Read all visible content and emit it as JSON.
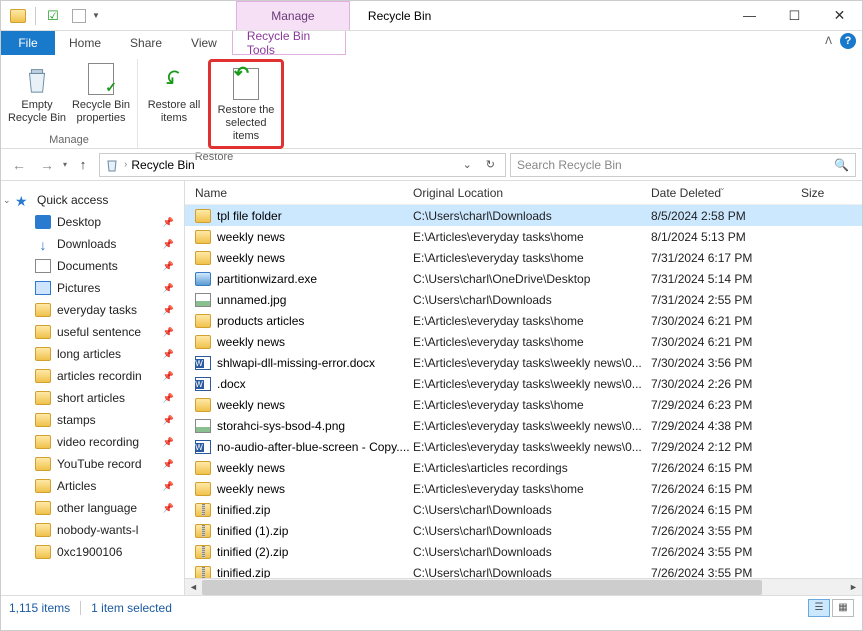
{
  "window": {
    "title": "Recycle Bin",
    "context_tab_header": "Manage",
    "min": "—",
    "max": "☐",
    "close": "✕"
  },
  "tabs": {
    "file": "File",
    "home": "Home",
    "share": "Share",
    "view": "View",
    "recycle_tools": "Recycle Bin Tools"
  },
  "ribbon": {
    "manage": {
      "label": "Manage",
      "empty": "Empty Recycle Bin",
      "props": "Recycle Bin properties"
    },
    "restore": {
      "label": "Restore",
      "all": "Restore all items",
      "selected": "Restore the selected items"
    }
  },
  "nav": {
    "location": "Recycle Bin",
    "search_placeholder": "Search Recycle Bin"
  },
  "columns": {
    "name": "Name",
    "loc": "Original Location",
    "date": "Date Deleted",
    "size": "Size"
  },
  "sidebar": {
    "quick": "Quick access",
    "items": [
      {
        "label": "Desktop",
        "icon": "desktop",
        "pin": true
      },
      {
        "label": "Downloads",
        "icon": "down",
        "pin": true
      },
      {
        "label": "Documents",
        "icon": "doc",
        "pin": true
      },
      {
        "label": "Pictures",
        "icon": "pic",
        "pin": true
      },
      {
        "label": "everyday tasks",
        "icon": "folder",
        "pin": true
      },
      {
        "label": "useful sentence",
        "icon": "folder",
        "pin": true
      },
      {
        "label": "long articles",
        "icon": "folder",
        "pin": true
      },
      {
        "label": "articles recordin",
        "icon": "folder",
        "pin": true
      },
      {
        "label": "short articles",
        "icon": "folder",
        "pin": true
      },
      {
        "label": "stamps",
        "icon": "folder",
        "pin": true
      },
      {
        "label": "video recording",
        "icon": "folder",
        "pin": true
      },
      {
        "label": "YouTube record",
        "icon": "folder",
        "pin": true
      },
      {
        "label": "Articles",
        "icon": "folder",
        "pin": true
      },
      {
        "label": "other language",
        "icon": "folder",
        "pin": true
      },
      {
        "label": "nobody-wants-l",
        "icon": "folder",
        "pin": false
      },
      {
        "label": "0xc1900106",
        "icon": "folder",
        "pin": false
      }
    ]
  },
  "files": [
    {
      "name": "tpl file folder",
      "icon": "folder",
      "loc": "C:\\Users\\charl\\Downloads",
      "date": "8/5/2024 2:58 PM",
      "selected": true
    },
    {
      "name": "weekly news",
      "icon": "folder",
      "loc": "E:\\Articles\\everyday tasks\\home",
      "date": "8/1/2024 5:13 PM"
    },
    {
      "name": "weekly news",
      "icon": "folder",
      "loc": "E:\\Articles\\everyday tasks\\home",
      "date": "7/31/2024 6:17 PM"
    },
    {
      "name": "partitionwizard.exe",
      "icon": "exe",
      "loc": "C:\\Users\\charl\\OneDrive\\Desktop",
      "date": "7/31/2024 5:14 PM"
    },
    {
      "name": "unnamed.jpg",
      "icon": "img",
      "loc": "C:\\Users\\charl\\Downloads",
      "date": "7/31/2024 2:55 PM"
    },
    {
      "name": "products articles",
      "icon": "folder",
      "loc": "E:\\Articles\\everyday tasks\\home",
      "date": "7/30/2024 6:21 PM"
    },
    {
      "name": "weekly news",
      "icon": "folder",
      "loc": "E:\\Articles\\everyday tasks\\home",
      "date": "7/30/2024 6:21 PM"
    },
    {
      "name": "shlwapi-dll-missing-error.docx",
      "icon": "doc",
      "loc": "E:\\Articles\\everyday tasks\\weekly news\\0...",
      "date": "7/30/2024 3:56 PM"
    },
    {
      "name": ".docx",
      "icon": "doc",
      "loc": "E:\\Articles\\everyday tasks\\weekly news\\0...",
      "date": "7/30/2024 2:26 PM"
    },
    {
      "name": "weekly news",
      "icon": "folder",
      "loc": "E:\\Articles\\everyday tasks\\home",
      "date": "7/29/2024 6:23 PM"
    },
    {
      "name": "storahci-sys-bsod-4.png",
      "icon": "img",
      "loc": "E:\\Articles\\everyday tasks\\weekly news\\0...",
      "date": "7/29/2024 4:38 PM"
    },
    {
      "name": "no-audio-after-blue-screen - Copy....",
      "icon": "doc",
      "loc": "E:\\Articles\\everyday tasks\\weekly news\\0...",
      "date": "7/29/2024 2:12 PM"
    },
    {
      "name": "weekly news",
      "icon": "folder",
      "loc": "E:\\Articles\\articles recordings",
      "date": "7/26/2024 6:15 PM"
    },
    {
      "name": "weekly news",
      "icon": "folder",
      "loc": "E:\\Articles\\everyday tasks\\home",
      "date": "7/26/2024 6:15 PM"
    },
    {
      "name": "tinified.zip",
      "icon": "zip",
      "loc": "C:\\Users\\charl\\Downloads",
      "date": "7/26/2024 6:15 PM"
    },
    {
      "name": "tinified (1).zip",
      "icon": "zip",
      "loc": "C:\\Users\\charl\\Downloads",
      "date": "7/26/2024 3:55 PM"
    },
    {
      "name": "tinified (2).zip",
      "icon": "zip",
      "loc": "C:\\Users\\charl\\Downloads",
      "date": "7/26/2024 3:55 PM"
    },
    {
      "name": "tinified.zip",
      "icon": "zip",
      "loc": "C:\\Users\\charl\\Downloads",
      "date": "7/26/2024 3:55 PM"
    }
  ],
  "status": {
    "count": "1,115 items",
    "selected": "1 item selected"
  }
}
